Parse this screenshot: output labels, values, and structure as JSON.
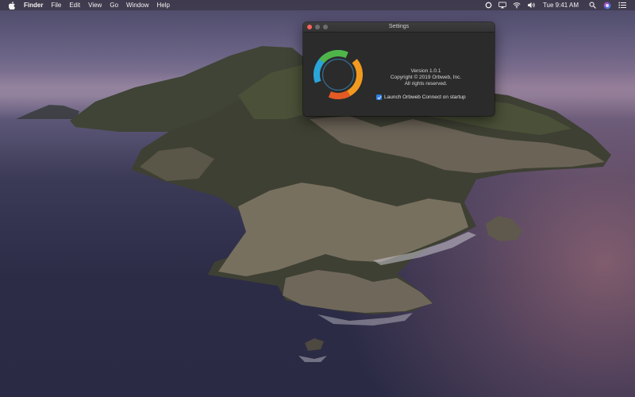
{
  "menubar": {
    "app_name": "Finder",
    "items": [
      "File",
      "Edit",
      "View",
      "Go",
      "Window",
      "Help"
    ],
    "clock": "Tue 9:41 AM",
    "status_icons": [
      "orbweb-status-icon",
      "airplay-icon",
      "wifi-icon",
      "volume-icon"
    ],
    "right_icons": [
      "spotlight-search-icon",
      "siri-icon",
      "notification-center-icon"
    ]
  },
  "settings_window": {
    "title": "Settings",
    "version": "Version 1.0.1",
    "copyright": "Copyright © 2019 Orbweb, Inc.",
    "rights": "All rights reserved.",
    "launch_checkbox": {
      "label": "Launch Orbweb Connect on startup",
      "checked": true
    },
    "logo_colors": [
      "#2aa4d9",
      "#f29a1f",
      "#4fb548",
      "#e45a24"
    ]
  },
  "wallpaper": "macOS Catalina island"
}
